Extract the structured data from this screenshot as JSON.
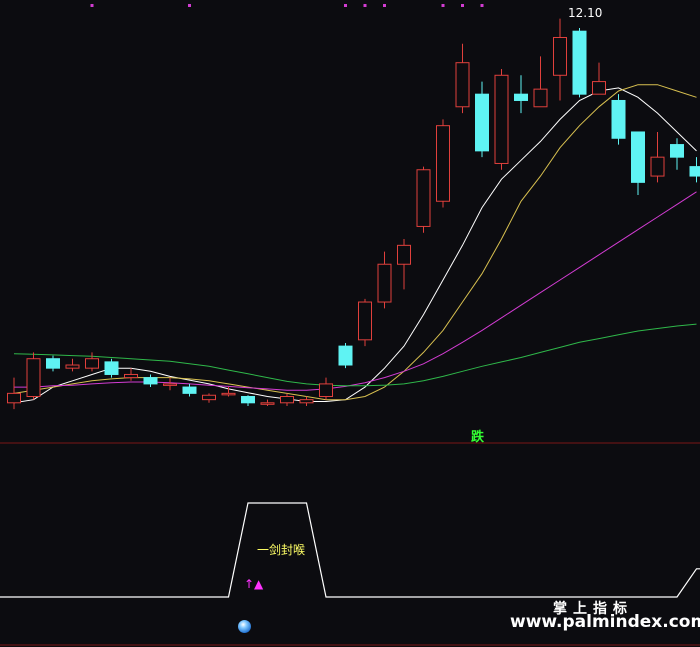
{
  "labels": {
    "high_price": "12.10",
    "signal": "跌",
    "pattern": "一剑封喉",
    "arrow": "↑▲",
    "brand": "掌上指标",
    "url": "www.palmindex.com"
  },
  "colors": {
    "background": "#0c0c10",
    "up_candle": "#e0403c",
    "down_candle": "#5ff3f3",
    "ma_white": "#ffffff",
    "ma_yellow": "#d8c050",
    "ma_magenta": "#d23cd2",
    "ma_green": "#2fb84a",
    "signal_top_dots": "#d23cd2",
    "separator": "#7a1616",
    "indicator_line": "#ffffff"
  },
  "chart_data": [
    {
      "type": "candlestick",
      "title": "",
      "price_max_label": "12.10",
      "candles": [
        {
          "o": 6.0,
          "c": 6.15,
          "h": 6.4,
          "l": 5.9
        },
        {
          "o": 6.1,
          "c": 6.7,
          "h": 6.8,
          "l": 6.05
        },
        {
          "o": 6.7,
          "c": 6.55,
          "h": 6.75,
          "l": 6.5
        },
        {
          "o": 6.55,
          "c": 6.6,
          "h": 6.7,
          "l": 6.5
        },
        {
          "o": 6.55,
          "c": 6.7,
          "h": 6.8,
          "l": 6.5
        },
        {
          "o": 6.65,
          "c": 6.45,
          "h": 6.7,
          "l": 6.4
        },
        {
          "o": 6.4,
          "c": 6.45,
          "h": 6.55,
          "l": 6.35
        },
        {
          "o": 6.4,
          "c": 6.3,
          "h": 6.45,
          "l": 6.25
        },
        {
          "o": 6.3,
          "c": 6.3,
          "h": 6.4,
          "l": 6.2
        },
        {
          "o": 6.25,
          "c": 6.15,
          "h": 6.3,
          "l": 6.1
        },
        {
          "o": 6.05,
          "c": 6.12,
          "h": 6.15,
          "l": 6.0
        },
        {
          "o": 6.15,
          "c": 6.15,
          "h": 6.25,
          "l": 6.1
        },
        {
          "o": 6.1,
          "c": 6.0,
          "h": 6.12,
          "l": 5.95
        },
        {
          "o": 6.0,
          "c": 6.0,
          "h": 6.05,
          "l": 5.95
        },
        {
          "o": 6.0,
          "c": 6.1,
          "h": 6.15,
          "l": 5.95
        },
        {
          "o": 6.0,
          "c": 6.05,
          "h": 6.1,
          "l": 5.95
        },
        {
          "o": 6.1,
          "c": 6.3,
          "h": 6.4,
          "l": 6.05
        },
        {
          "o": 6.9,
          "c": 6.6,
          "h": 6.95,
          "l": 6.55
        },
        {
          "o": 7.0,
          "c": 7.6,
          "h": 7.65,
          "l": 6.9
        },
        {
          "o": 7.6,
          "c": 8.2,
          "h": 8.4,
          "l": 7.5
        },
        {
          "o": 8.2,
          "c": 8.5,
          "h": 8.6,
          "l": 7.8
        },
        {
          "o": 8.8,
          "c": 9.7,
          "h": 9.75,
          "l": 8.7
        },
        {
          "o": 9.2,
          "c": 10.4,
          "h": 10.5,
          "l": 9.1
        },
        {
          "o": 10.7,
          "c": 11.4,
          "h": 11.7,
          "l": 10.6
        },
        {
          "o": 10.9,
          "c": 10.0,
          "h": 11.1,
          "l": 9.9
        },
        {
          "o": 9.8,
          "c": 11.2,
          "h": 11.3,
          "l": 9.7
        },
        {
          "o": 10.9,
          "c": 10.8,
          "h": 11.2,
          "l": 10.6
        },
        {
          "o": 10.7,
          "c": 10.98,
          "h": 11.5,
          "l": 10.7
        },
        {
          "o": 11.2,
          "c": 11.8,
          "h": 12.1,
          "l": 10.8
        },
        {
          "o": 11.9,
          "c": 10.9,
          "h": 11.95,
          "l": 10.85
        },
        {
          "o": 10.9,
          "c": 11.1,
          "h": 11.4,
          "l": 10.9
        },
        {
          "o": 10.8,
          "c": 10.2,
          "h": 10.9,
          "l": 10.1
        },
        {
          "o": 10.3,
          "c": 9.5,
          "h": 10.3,
          "l": 9.3
        },
        {
          "o": 9.6,
          "c": 9.9,
          "h": 10.3,
          "l": 9.5
        },
        {
          "o": 10.1,
          "c": 9.9,
          "h": 10.2,
          "l": 9.7
        },
        {
          "o": 9.75,
          "c": 9.6,
          "h": 9.9,
          "l": 9.5
        }
      ],
      "moving_averages": [
        {
          "color_key": "ma_white",
          "values": [
            6.0,
            6.05,
            6.25,
            6.35,
            6.45,
            6.55,
            6.55,
            6.5,
            6.42,
            6.36,
            6.3,
            6.22,
            6.16,
            6.1,
            6.06,
            6.02,
            6.02,
            6.05,
            6.25,
            6.55,
            6.9,
            7.4,
            7.95,
            8.5,
            9.1,
            9.55,
            9.85,
            10.15,
            10.5,
            10.8,
            10.95,
            11.0,
            10.85,
            10.6,
            10.3,
            10.0
          ]
        },
        {
          "color_key": "ma_yellow",
          "values": [
            6.15,
            6.2,
            6.25,
            6.3,
            6.35,
            6.38,
            6.4,
            6.4,
            6.4,
            6.38,
            6.35,
            6.3,
            6.25,
            6.2,
            6.15,
            6.1,
            6.05,
            6.05,
            6.1,
            6.25,
            6.5,
            6.8,
            7.15,
            7.6,
            8.05,
            8.6,
            9.2,
            9.6,
            10.05,
            10.4,
            10.7,
            10.95,
            11.05,
            11.05,
            10.95,
            10.85
          ]
        },
        {
          "color_key": "ma_magenta",
          "values": [
            6.25,
            6.25,
            6.27,
            6.28,
            6.3,
            6.32,
            6.33,
            6.33,
            6.32,
            6.3,
            6.28,
            6.26,
            6.24,
            6.22,
            6.2,
            6.2,
            6.22,
            6.26,
            6.32,
            6.4,
            6.5,
            6.62,
            6.78,
            6.96,
            7.15,
            7.35,
            7.55,
            7.75,
            7.95,
            8.15,
            8.35,
            8.55,
            8.75,
            8.95,
            9.15,
            9.35
          ]
        },
        {
          "color_key": "ma_green",
          "values": [
            6.78,
            6.77,
            6.76,
            6.75,
            6.74,
            6.72,
            6.7,
            6.68,
            6.66,
            6.62,
            6.58,
            6.52,
            6.46,
            6.4,
            6.34,
            6.3,
            6.28,
            6.27,
            6.27,
            6.28,
            6.3,
            6.35,
            6.42,
            6.5,
            6.58,
            6.65,
            6.72,
            6.8,
            6.88,
            6.96,
            7.02,
            7.08,
            7.14,
            7.18,
            7.22,
            7.25
          ]
        }
      ],
      "top_marker_candles": [
        4,
        9,
        17,
        18,
        19,
        22,
        23,
        24
      ]
    },
    {
      "type": "line",
      "title": "",
      "signal_values": [
        0,
        0,
        0,
        0,
        0,
        0,
        0,
        0,
        0,
        0,
        0,
        0,
        1,
        1,
        1,
        1,
        0,
        0,
        0,
        0,
        0,
        0,
        0,
        0,
        0,
        0,
        0,
        0,
        0,
        0,
        0,
        0,
        0,
        0,
        0,
        0.3
      ],
      "ylim": [
        0,
        1
      ]
    }
  ]
}
